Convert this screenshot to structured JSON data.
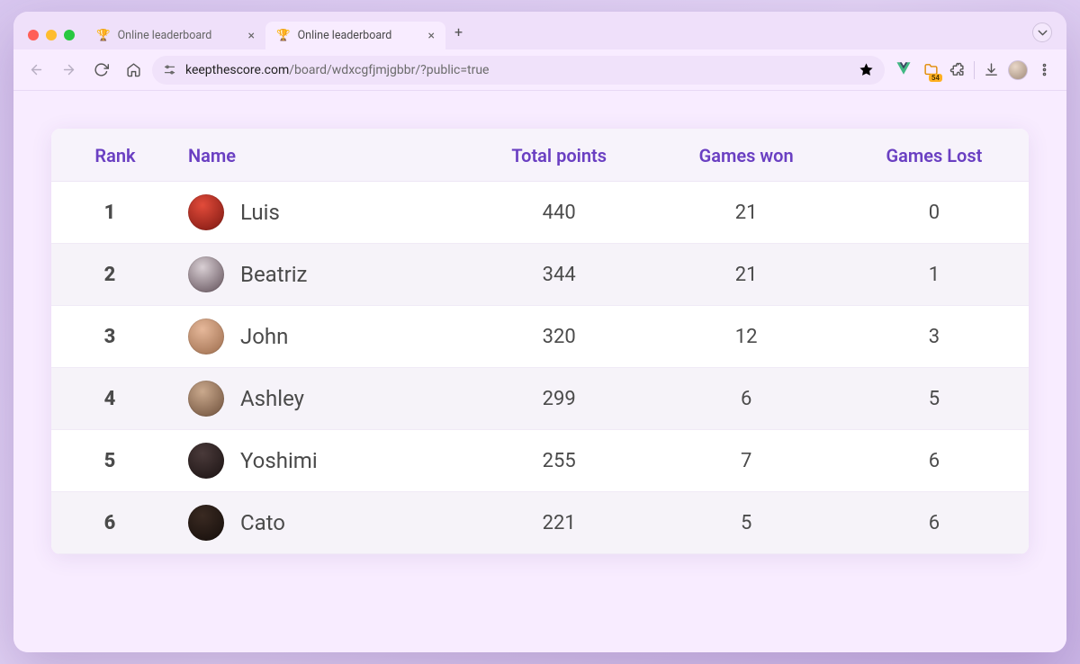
{
  "browser": {
    "tabs": [
      {
        "title": "Online leaderboard",
        "icon": "🏆",
        "active": false
      },
      {
        "title": "Online leaderboard",
        "icon": "🏆",
        "active": true
      }
    ],
    "url_host": "keepthescore.com",
    "url_path": "/board/wdxcgfjmjgbbr/?public=true",
    "extension_badge": "54"
  },
  "leaderboard": {
    "headers": {
      "rank": "Rank",
      "name": "Name",
      "total_points": "Total points",
      "games_won": "Games won",
      "games_lost": "Games Lost"
    },
    "rows": [
      {
        "rank": "1",
        "name": "Luis",
        "total_points": "440",
        "games_won": "21",
        "games_lost": "0"
      },
      {
        "rank": "2",
        "name": "Beatriz",
        "total_points": "344",
        "games_won": "21",
        "games_lost": "1"
      },
      {
        "rank": "3",
        "name": "John",
        "total_points": "320",
        "games_won": "12",
        "games_lost": "3"
      },
      {
        "rank": "4",
        "name": "Ashley",
        "total_points": "299",
        "games_won": "6",
        "games_lost": "5"
      },
      {
        "rank": "5",
        "name": "Yoshimi",
        "total_points": "255",
        "games_won": "7",
        "games_lost": "6"
      },
      {
        "rank": "6",
        "name": "Cato",
        "total_points": "221",
        "games_won": "5",
        "games_lost": "6"
      }
    ]
  }
}
